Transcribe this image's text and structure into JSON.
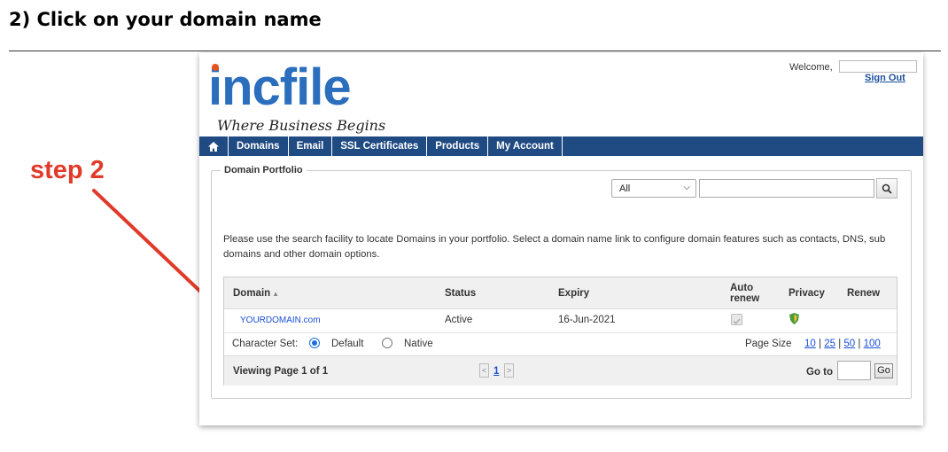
{
  "doc": {
    "heading": "2) Click on your domain name",
    "step_label": "step 2",
    "arrow_color": "#e13a2a"
  },
  "header": {
    "logo_text": "incfile",
    "tagline": "Where Business Begins",
    "welcome": "Welcome,",
    "sign_out": "Sign Out",
    "brand_color": "#2a6ebd"
  },
  "nav": {
    "home_icon": "home-icon",
    "items": [
      "Domains",
      "Email",
      "SSL Certificates",
      "Products",
      "My Account"
    ],
    "bar_color": "#1f4a82"
  },
  "portfolio": {
    "legend": "Domain Portfolio",
    "filter_selected": "All",
    "search_placeholder": "",
    "search_icon": "search-icon",
    "instructions": "Please use the search facility to locate Domains in your portfolio. Select a domain name link to configure domain features such as contacts, DNS, sub domains and other domain options.",
    "columns": {
      "domain": "Domain",
      "status": "Status",
      "expiry": "Expiry",
      "auto_renew": "Auto renew",
      "privacy": "Privacy",
      "renew": "Renew"
    },
    "rows": [
      {
        "domain": "YOURDOMAIN.com",
        "status": "Active",
        "expiry": "16-Jun-2021",
        "auto_renew": true
      }
    ],
    "charset": {
      "label": "Character Set:",
      "default_label": "Default",
      "native_label": "Native",
      "selected": "Default"
    },
    "page_size": {
      "label": "Page Size",
      "options": [
        "10",
        "25",
        "50",
        "100"
      ],
      "sep": "|"
    },
    "pager": {
      "viewing": "Viewing Page 1 of 1",
      "current_page": "1",
      "prev": "<",
      "next": ">",
      "goto_label": "Go to",
      "go_button": "Go"
    }
  }
}
